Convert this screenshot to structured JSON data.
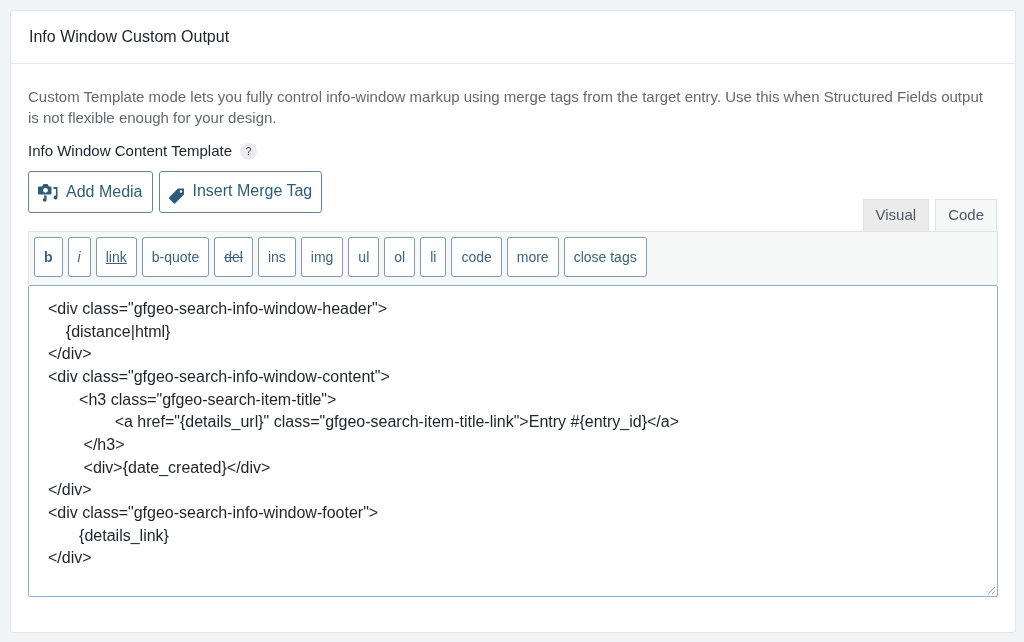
{
  "panel": {
    "title": "Info Window Custom Output"
  },
  "description": "Custom Template mode lets you fully control info-window markup using merge tags from the target entry. Use this when Structured Fields output is not flexible enough for your design.",
  "field": {
    "label": "Info Window Content Template",
    "help": "?"
  },
  "media_buttons": [
    {
      "label": "Add Media",
      "kind": "media"
    },
    {
      "label": "Insert Merge Tag",
      "kind": "tag"
    }
  ],
  "editor_tabs": [
    {
      "label": "Visual",
      "selected": false
    },
    {
      "label": "Code",
      "selected": true
    }
  ],
  "quicktags": [
    {
      "label": "b",
      "kind": "bold"
    },
    {
      "label": "i",
      "kind": "italic"
    },
    {
      "label": "link",
      "kind": "underline"
    },
    {
      "label": "b-quote",
      "kind": "plain"
    },
    {
      "label": "del",
      "kind": "strike"
    },
    {
      "label": "ins",
      "kind": "plain"
    },
    {
      "label": "img",
      "kind": "plain"
    },
    {
      "label": "ul",
      "kind": "plain"
    },
    {
      "label": "ol",
      "kind": "plain"
    },
    {
      "label": "li",
      "kind": "plain"
    },
    {
      "label": "code",
      "kind": "plain"
    },
    {
      "label": "more",
      "kind": "plain"
    },
    {
      "label": "close tags",
      "kind": "plain"
    }
  ],
  "template": {
    "value": "<div class=\"gfgeo-search-info-window-header\">\n    {distance|html}\n</div>\n<div class=\"gfgeo-search-info-window-content\">\n       <h3 class=\"gfgeo-search-item-title\">\n               <a href=\"{details_url}\" class=\"gfgeo-search-item-title-link\">Entry #{entry_id}</a>\n        </h3>\n        <div>{date_created}</div>\n</div>\n<div class=\"gfgeo-search-info-window-footer\">\n       {details_link}\n</div>"
  }
}
